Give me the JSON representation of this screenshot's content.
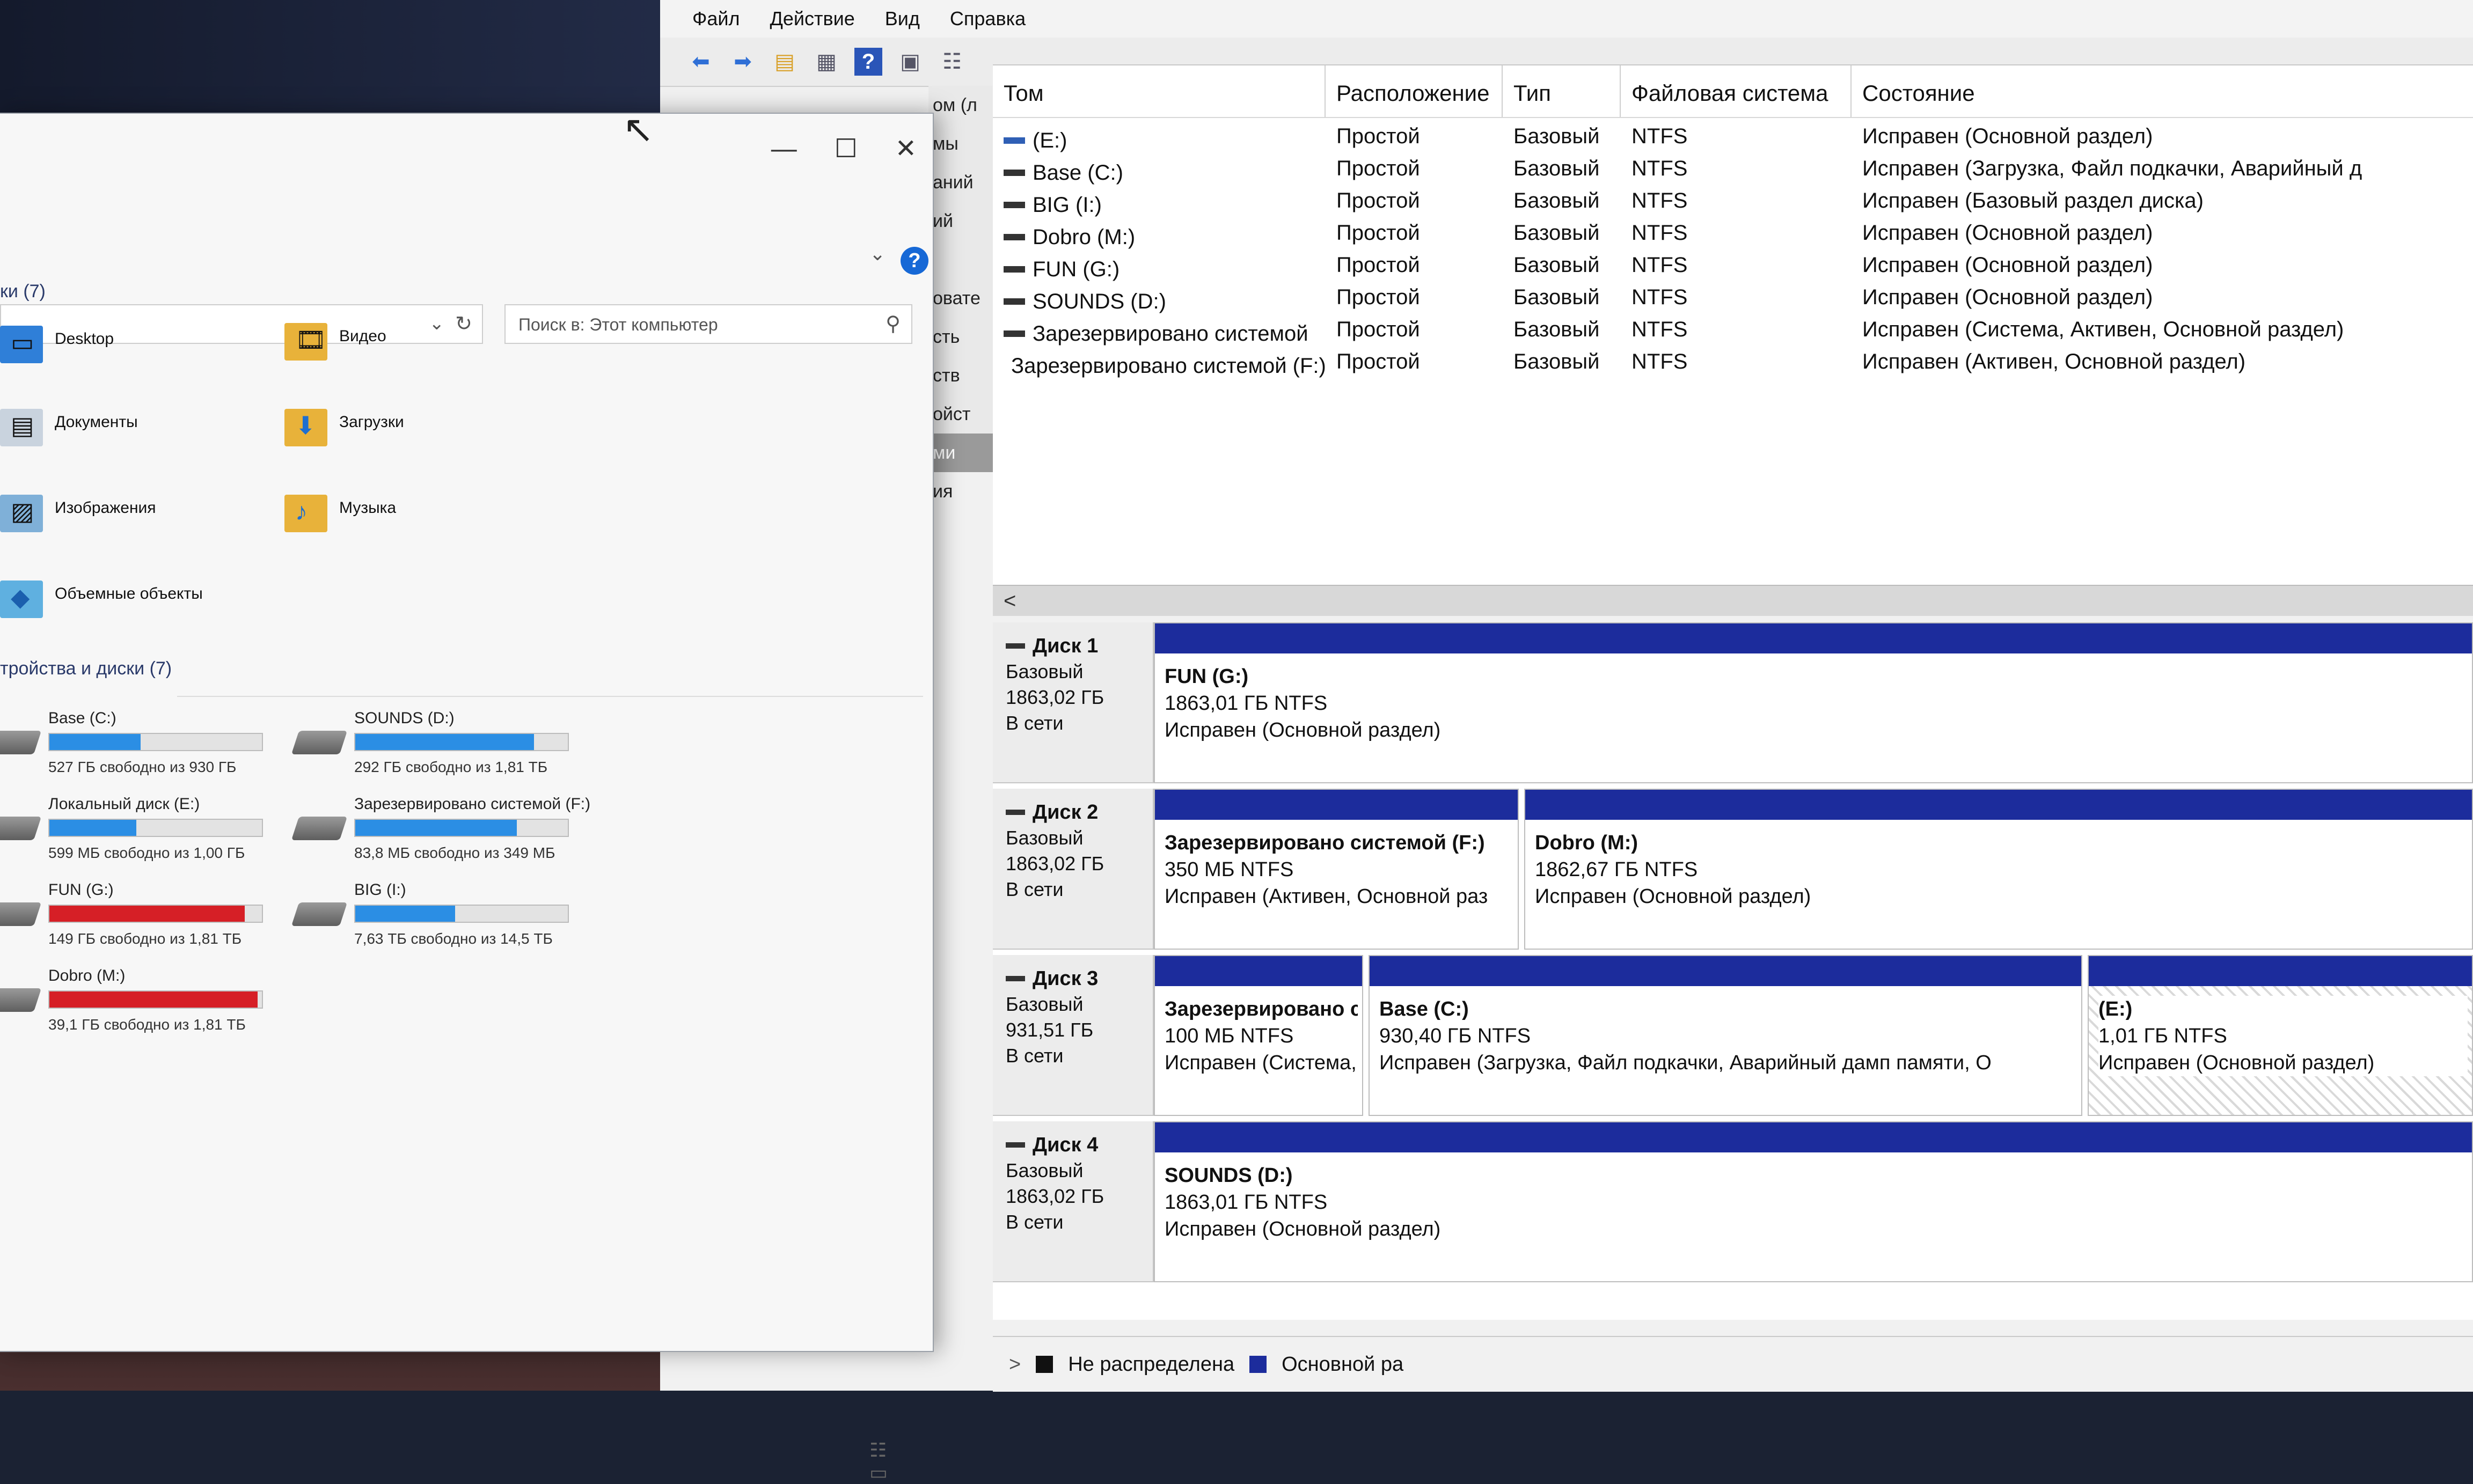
{
  "colors": {
    "accent": "#1668d6",
    "partition_primary": "#1c2c9c",
    "drive_bar_ok": "#2b8ee4",
    "drive_bar_full": "#d61f26",
    "unallocated": "#111111"
  },
  "dm": {
    "menu": [
      "Файл",
      "Действие",
      "Вид",
      "Справка"
    ],
    "toolbar_icons": [
      "back-arrow-icon",
      "forward-arrow-icon",
      "folder-up-icon",
      "properties-icon",
      "help-icon",
      "console-icon",
      "list-icon"
    ],
    "left_strip": [
      "ом (л",
      "мы",
      "аний",
      "ий",
      "",
      "овате",
      "сть",
      "ств",
      "ойст",
      "ми",
      "ия"
    ],
    "columns": [
      "Том",
      "Расположение",
      "Тип",
      "Файловая система",
      "Состояние"
    ],
    "volumes": [
      {
        "name": "(E:)",
        "layout": "Простой",
        "type": "Базовый",
        "fs": "NTFS",
        "status": "Исправен (Основной раздел)",
        "icon": "blue"
      },
      {
        "name": "Base (C:)",
        "layout": "Простой",
        "type": "Базовый",
        "fs": "NTFS",
        "status": "Исправен (Загрузка, Файл подкачки, Аварийный д",
        "icon": "dark"
      },
      {
        "name": "BIG (I:)",
        "layout": "Простой",
        "type": "Базовый",
        "fs": "NTFS",
        "status": "Исправен (Базовый раздел диска)",
        "icon": "dark"
      },
      {
        "name": "Dobro (M:)",
        "layout": "Простой",
        "type": "Базовый",
        "fs": "NTFS",
        "status": "Исправен (Основной раздел)",
        "icon": "dark"
      },
      {
        "name": "FUN (G:)",
        "layout": "Простой",
        "type": "Базовый",
        "fs": "NTFS",
        "status": "Исправен (Основной раздел)",
        "icon": "dark"
      },
      {
        "name": "SOUNDS (D:)",
        "layout": "Простой",
        "type": "Базовый",
        "fs": "NTFS",
        "status": "Исправен (Основной раздел)",
        "icon": "dark"
      },
      {
        "name": "Зарезервировано системой",
        "layout": "Простой",
        "type": "Базовый",
        "fs": "NTFS",
        "status": "Исправен (Система, Активен, Основной раздел)",
        "icon": "dark"
      },
      {
        "name": "Зарезервировано системой (F:)",
        "layout": "Простой",
        "type": "Базовый",
        "fs": "NTFS",
        "status": "Исправен (Активен, Основной раздел)",
        "icon": "dark"
      }
    ],
    "scroll_left": "<",
    "disks": [
      {
        "name": "Диск 1",
        "type": "Базовый",
        "size": "1863,02 ГБ",
        "state": "В сети",
        "parts": [
          {
            "name": "FUN  (G:)",
            "size": "1863,01 ГБ NTFS",
            "status": "Исправен (Основной раздел)"
          }
        ]
      },
      {
        "name": "Диск 2",
        "type": "Базовый",
        "size": "1863,02 ГБ",
        "state": "В сети",
        "parts": [
          {
            "name": "Зарезервировано системой  (F:)",
            "size": "350 МБ NTFS",
            "status": "Исправен (Активен, Основной раз"
          },
          {
            "name": "Dobro  (M:)",
            "size": "1862,67 ГБ NTFS",
            "status": "Исправен (Основной раздел)"
          }
        ]
      },
      {
        "name": "Диск 3",
        "type": "Базовый",
        "size": "931,51 ГБ",
        "state": "В сети",
        "parts": [
          {
            "name": "Зарезервировано с",
            "size": "100 МБ NTFS",
            "status": "Исправен (Система,"
          },
          {
            "name": "Base  (C:)",
            "size": "930,40 ГБ NTFS",
            "status": "Исправен (Загрузка, Файл подкачки, Аварийный дамп памяти, О"
          },
          {
            "name": "(E:)",
            "size": "1,01 ГБ NTFS",
            "status": "Исправен (Основной раздел)"
          }
        ]
      },
      {
        "name": "Диск 4",
        "type": "Базовый",
        "size": "1863,02 ГБ",
        "state": "В сети",
        "parts": [
          {
            "name": "SOUNDS  (D:)",
            "size": "1863,01 ГБ NTFS",
            "status": "Исправен (Основной раздел)"
          }
        ]
      }
    ],
    "legend": [
      {
        "label": "Не распределена"
      },
      {
        "label": "Основной ра"
      }
    ],
    "legend_arrow": ">"
  },
  "explorer": {
    "caption": {
      "minimize": "—",
      "maximize": "☐",
      "close": "✕"
    },
    "chevron": "⌄",
    "help": "?",
    "address_dropdown": "⌄",
    "refresh": "↻",
    "search_placeholder": "Поиск в: Этот компьютер",
    "search_icon": "⚲",
    "folders_header": "ки (7)",
    "folders": [
      {
        "label": "Desktop",
        "glyph": "▭"
      },
      {
        "label": "Видео",
        "glyph": "🎞"
      },
      {
        "label": "Документы",
        "glyph": "▤"
      },
      {
        "label": "Загрузки",
        "glyph": "⬇"
      },
      {
        "label": "Изображения",
        "glyph": "▨"
      },
      {
        "label": "Музыка",
        "glyph": "♪"
      },
      {
        "label": "Объемные объекты",
        "glyph": "◆"
      }
    ],
    "drives_header": "тройства и диски (7)",
    "drives": [
      {
        "name": "Base (C:)",
        "free": "527 ГБ свободно из 930 ГБ",
        "used_fraction": 0.43,
        "full": false
      },
      {
        "name": "SOUNDS (D:)",
        "free": "292 ГБ свободно из 1,81 ТБ",
        "used_fraction": 0.84,
        "full": false
      },
      {
        "name": "Локальный диск (E:)",
        "free": "599 МБ свободно из 1,00 ГБ",
        "used_fraction": 0.41,
        "full": false
      },
      {
        "name": "Зарезервировано системой (F:)",
        "free": "83,8 МБ свободно из 349 МБ",
        "used_fraction": 0.76,
        "full": false
      },
      {
        "name": "FUN (G:)",
        "free": "149 ГБ свободно из 1,81 ТБ",
        "used_fraction": 0.92,
        "full": true
      },
      {
        "name": "BIG (I:)",
        "free": "7,63 ТБ свободно из 14,5 ТБ",
        "used_fraction": 0.47,
        "full": false
      },
      {
        "name": "Dobro (M:)",
        "free": "39,1 ГБ свободно из 1,81 ТБ",
        "used_fraction": 0.98,
        "full": true
      }
    ],
    "view_icons": "☷ ▭"
  }
}
